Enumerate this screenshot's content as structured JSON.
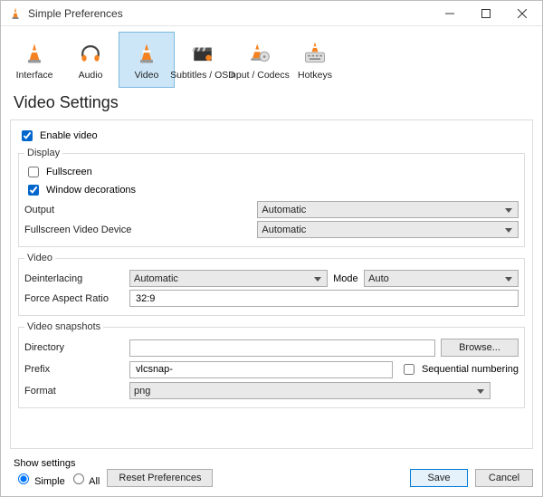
{
  "window": {
    "title": "Simple Preferences"
  },
  "tabs": {
    "interface": "Interface",
    "audio": "Audio",
    "video": "Video",
    "subtitles": "Subtitles / OSD",
    "input": "Input / Codecs",
    "hotkeys": "Hotkeys"
  },
  "heading": "Video Settings",
  "enable_video": "Enable video",
  "display": {
    "legend": "Display",
    "fullscreen": "Fullscreen",
    "window_decorations": "Window decorations",
    "output_label": "Output",
    "output_value": "Automatic",
    "fsdevice_label": "Fullscreen Video Device",
    "fsdevice_value": "Automatic"
  },
  "video": {
    "legend": "Video",
    "deinterlacing_label": "Deinterlacing",
    "deinterlacing_value": "Automatic",
    "mode_label": "Mode",
    "mode_value": "Auto",
    "force_ar_label": "Force Aspect Ratio",
    "force_ar_value": "32:9"
  },
  "snapshots": {
    "legend": "Video snapshots",
    "directory_label": "Directory",
    "directory_value": "",
    "browse": "Browse...",
    "prefix_label": "Prefix",
    "prefix_value": "vlcsnap-",
    "seq_numbering": "Sequential numbering",
    "format_label": "Format",
    "format_value": "png"
  },
  "footer": {
    "show_settings": "Show settings",
    "simple": "Simple",
    "all": "All",
    "reset": "Reset Preferences",
    "save": "Save",
    "cancel": "Cancel"
  }
}
